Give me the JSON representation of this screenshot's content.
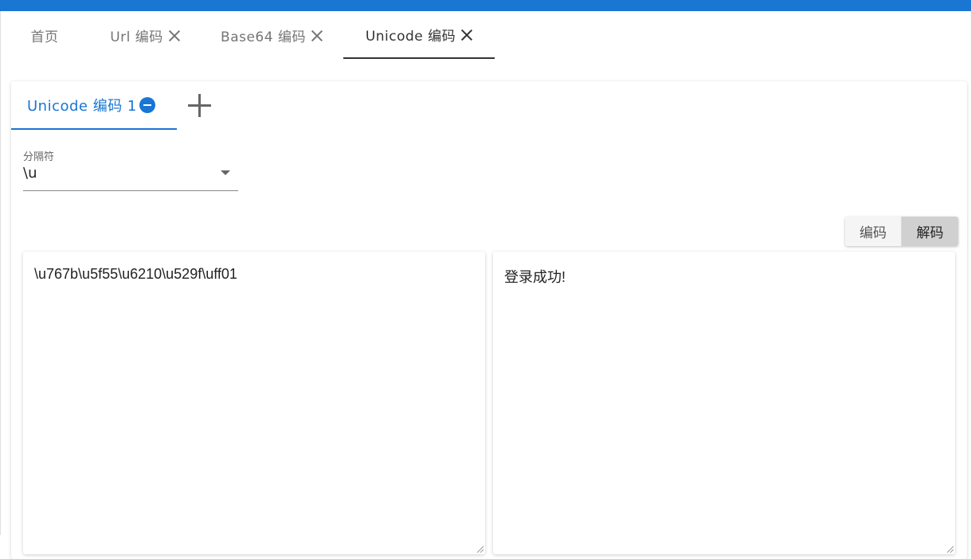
{
  "top_tabs": [
    {
      "label": "首页"
    },
    {
      "label": "Url 编码"
    },
    {
      "label": "Base64 编码"
    },
    {
      "label": "Unicode 编码"
    }
  ],
  "inner_tab": {
    "label": "Unicode 编码 1"
  },
  "separator": {
    "label": "分隔符",
    "value": "\\u"
  },
  "mode": {
    "encode_label": "编码",
    "decode_label": "解码",
    "active": "decode"
  },
  "input_text": "\\u767b\\u5f55\\u6210\\u529f\\uff01",
  "output_text": "登录成功!",
  "colors": {
    "accent": "#1976d2",
    "active_toggle": "#d0d0d0"
  },
  "icons": {
    "close": "close-icon",
    "remove": "minus-circle-icon",
    "add": "plus-icon",
    "dropdown": "caret-down-icon"
  }
}
